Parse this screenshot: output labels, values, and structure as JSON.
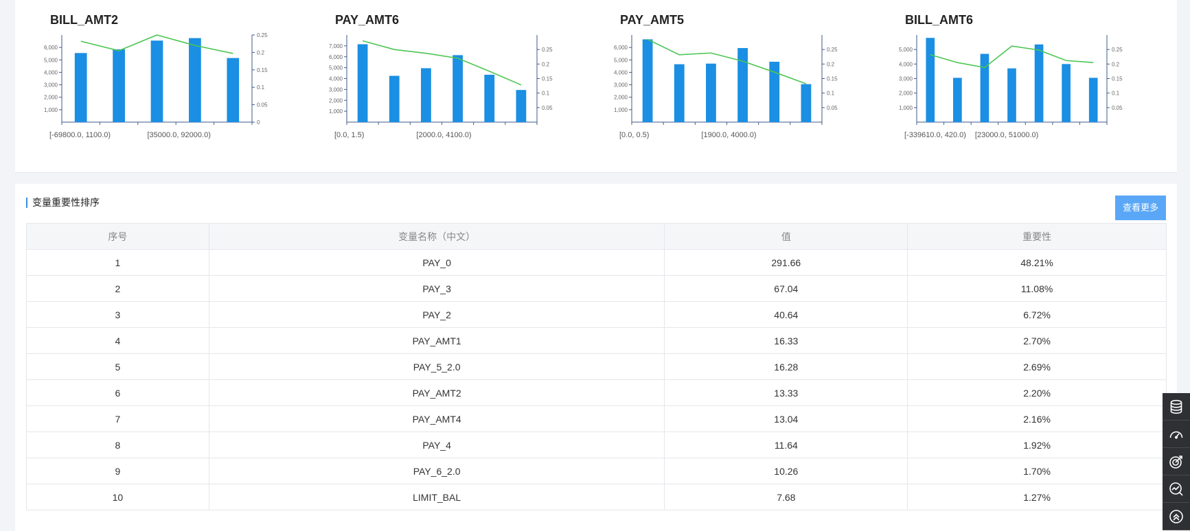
{
  "charts": [
    {
      "title": "BILL_AMT2",
      "chart_data": {
        "type": "bar",
        "categories": [
          "[-69800.0, 1100.0)",
          "",
          "",
          "[35000.0, 92000.0)",
          ""
        ],
        "x_tick_labels": [
          "[-69800.0, 1100.0)",
          "[35000.0, 92000.0)"
        ],
        "values": [
          5550,
          5850,
          6550,
          6750,
          5150
        ],
        "line_values": [
          0.232,
          0.205,
          0.25,
          0.22,
          0.197
        ],
        "ylim": [
          0,
          7000
        ],
        "y_ticks": [
          "1,000",
          "2,000",
          "3,000",
          "4,000",
          "5,000",
          "6,000"
        ],
        "y2lim": [
          0,
          0.25
        ],
        "y2_ticks": [
          "0",
          "0.05",
          "0.1",
          "0.15",
          "0.2",
          "0.25"
        ],
        "bar_color": "#1a8fe3",
        "line_color": "#4cc552"
      }
    },
    {
      "title": "PAY_AMT6",
      "chart_data": {
        "type": "bar",
        "categories": [
          "[0.0, 1.5)",
          "",
          "",
          "[2000.0, 4100.0)",
          "",
          ""
        ],
        "x_tick_labels": [
          "[0.0, 1.5)",
          "[2000.0, 4100.0)"
        ],
        "values": [
          7150,
          4250,
          4950,
          6150,
          4350,
          2950
        ],
        "line_values": [
          0.28,
          0.25,
          0.237,
          0.22,
          0.175,
          0.128
        ],
        "ylim": [
          0,
          8000
        ],
        "y_ticks": [
          "1,000",
          "2,000",
          "3,000",
          "4,000",
          "5,000",
          "6,000",
          "7,000"
        ],
        "y2lim": [
          0,
          0.3
        ],
        "y2_ticks": [
          "0.05",
          "0.1",
          "0.15",
          "0.2",
          "0.25"
        ],
        "bar_color": "#1a8fe3",
        "line_color": "#4cc552"
      }
    },
    {
      "title": "PAY_AMT5",
      "chart_data": {
        "type": "bar",
        "categories": [
          "[0.0, 0.5)",
          "",
          "",
          "[1900.0, 4000.0)",
          "",
          ""
        ],
        "x_tick_labels": [
          "[0.0, 0.5)",
          "[1900.0, 4000.0)"
        ],
        "values": [
          6650,
          4650,
          4700,
          5950,
          4850,
          3050
        ],
        "line_values": [
          0.285,
          0.232,
          0.238,
          0.21,
          0.172,
          0.132
        ],
        "ylim": [
          0,
          7000
        ],
        "y_ticks": [
          "1,000",
          "2,000",
          "3,000",
          "4,000",
          "5,000",
          "6,000"
        ],
        "y2lim": [
          0,
          0.3
        ],
        "y2_ticks": [
          "0.05",
          "0.1",
          "0.15",
          "0.2",
          "0.25"
        ],
        "bar_color": "#1a8fe3",
        "line_color": "#4cc552"
      }
    },
    {
      "title": "BILL_AMT6",
      "chart_data": {
        "type": "bar",
        "categories": [
          "[-339610.0, 420.0)",
          "",
          "",
          "[23000.0, 51000.0)",
          "",
          "",
          ""
        ],
        "x_tick_labels": [
          "[-339610.0, 420.0)",
          "[23000.0, 51000.0)"
        ],
        "values": [
          5800,
          3050,
          4700,
          3700,
          5350,
          4000,
          3050
        ],
        "line_values": [
          0.232,
          0.205,
          0.188,
          0.262,
          0.248,
          0.212,
          0.205
        ],
        "ylim": [
          0,
          6000
        ],
        "y_ticks": [
          "1,000",
          "2,000",
          "3,000",
          "4,000",
          "5,000"
        ],
        "y2lim": [
          0,
          0.3
        ],
        "y2_ticks": [
          "0.05",
          "0.1",
          "0.15",
          "0.2",
          "0.25"
        ],
        "bar_color": "#1a8fe3",
        "line_color": "#4cc552"
      }
    }
  ],
  "importance": {
    "title": "变量重要性排序",
    "more_label": "查看更多",
    "columns": [
      "序号",
      "变量名称（中文）",
      "值",
      "重要性"
    ],
    "rows": [
      [
        "1",
        "PAY_0",
        "291.66",
        "48.21%"
      ],
      [
        "2",
        "PAY_3",
        "67.04",
        "11.08%"
      ],
      [
        "3",
        "PAY_2",
        "40.64",
        "6.72%"
      ],
      [
        "4",
        "PAY_AMT1",
        "16.33",
        "2.70%"
      ],
      [
        "5",
        "PAY_5_2.0",
        "16.28",
        "2.69%"
      ],
      [
        "6",
        "PAY_AMT2",
        "13.33",
        "2.20%"
      ],
      [
        "7",
        "PAY_AMT4",
        "13.04",
        "2.16%"
      ],
      [
        "8",
        "PAY_4",
        "11.64",
        "1.92%"
      ],
      [
        "9",
        "PAY_6_2.0",
        "10.26",
        "1.70%"
      ],
      [
        "10",
        "LIMIT_BAL",
        "7.68",
        "1.27%"
      ]
    ]
  },
  "toolbar": {
    "icons": [
      "database-icon",
      "dashboard-gauge-icon",
      "target-icon",
      "chart-search-icon",
      "scroll-top-icon"
    ]
  }
}
